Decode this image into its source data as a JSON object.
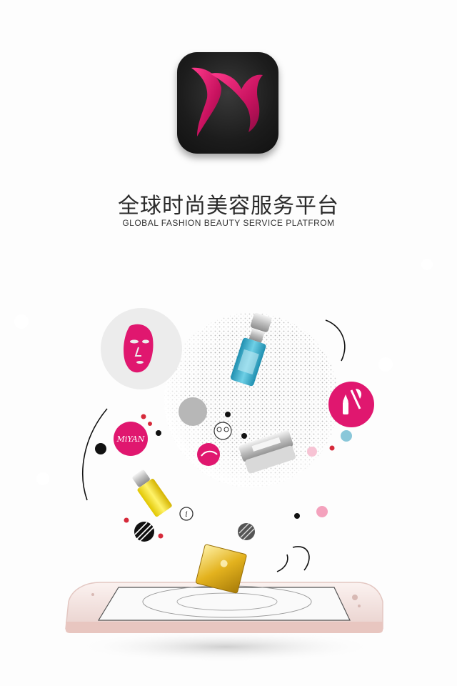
{
  "app": {
    "logo_icon": "m-logo-icon",
    "title": "全球时尚美容服务平台",
    "subtitle": "GLOBAL  FASHION  BEAUTY  SERVICE  PLATFROM",
    "brand_badge": "MiYAN"
  },
  "colors": {
    "accent": "#e0176f",
    "logo_bg": "#1e1e1e",
    "phone": "#f3e3e1"
  }
}
